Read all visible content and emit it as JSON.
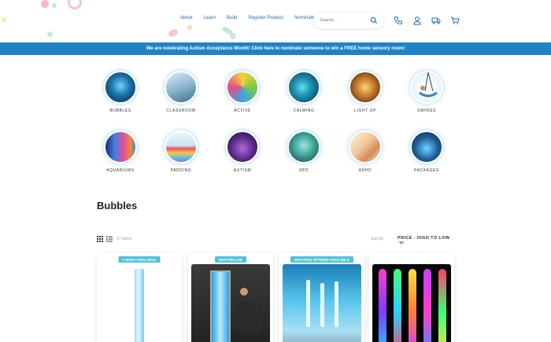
{
  "nav": {
    "items": [
      "About",
      "Learn",
      "Build",
      "Register Product",
      "Nominate"
    ]
  },
  "search": {
    "placeholder": "Search..."
  },
  "header_icons": [
    "phone-icon",
    "user-icon",
    "truck-icon",
    "cart-icon"
  ],
  "banner": {
    "text": "We are celebrating Autism Acceptance Month! Click here to nominate someone to win a FREE home sensory room!"
  },
  "categories": [
    {
      "label": "BUBBLES"
    },
    {
      "label": "CLASSROOM"
    },
    {
      "label": "ACTIVE"
    },
    {
      "label": "CALMING"
    },
    {
      "label": "LIGHT UP"
    },
    {
      "label": "SWINGS"
    },
    {
      "label": "AQUARIUMS"
    },
    {
      "label": "PADDING"
    },
    {
      "label": "AUTISM"
    },
    {
      "label": "SPD"
    },
    {
      "label": "ADHD"
    },
    {
      "label": "PACKAGES"
    }
  ],
  "section": {
    "title": "Bubbles"
  },
  "toolbar": {
    "count": "17 Items",
    "sort_label": "Sort by",
    "sort_value": "PRICE - HIGH TO LOW"
  },
  "products": [
    {
      "badge": "3 SIZES AVAILABLE"
    },
    {
      "badge": "BESTSELLER"
    },
    {
      "badge": "MULTIPLE OPTIONS AVAILABLE"
    },
    {
      "badge": ""
    }
  ],
  "colors": {
    "banner": "#1f83c6",
    "nav": "#1f6fb2",
    "badge": "#4fc3d8"
  }
}
